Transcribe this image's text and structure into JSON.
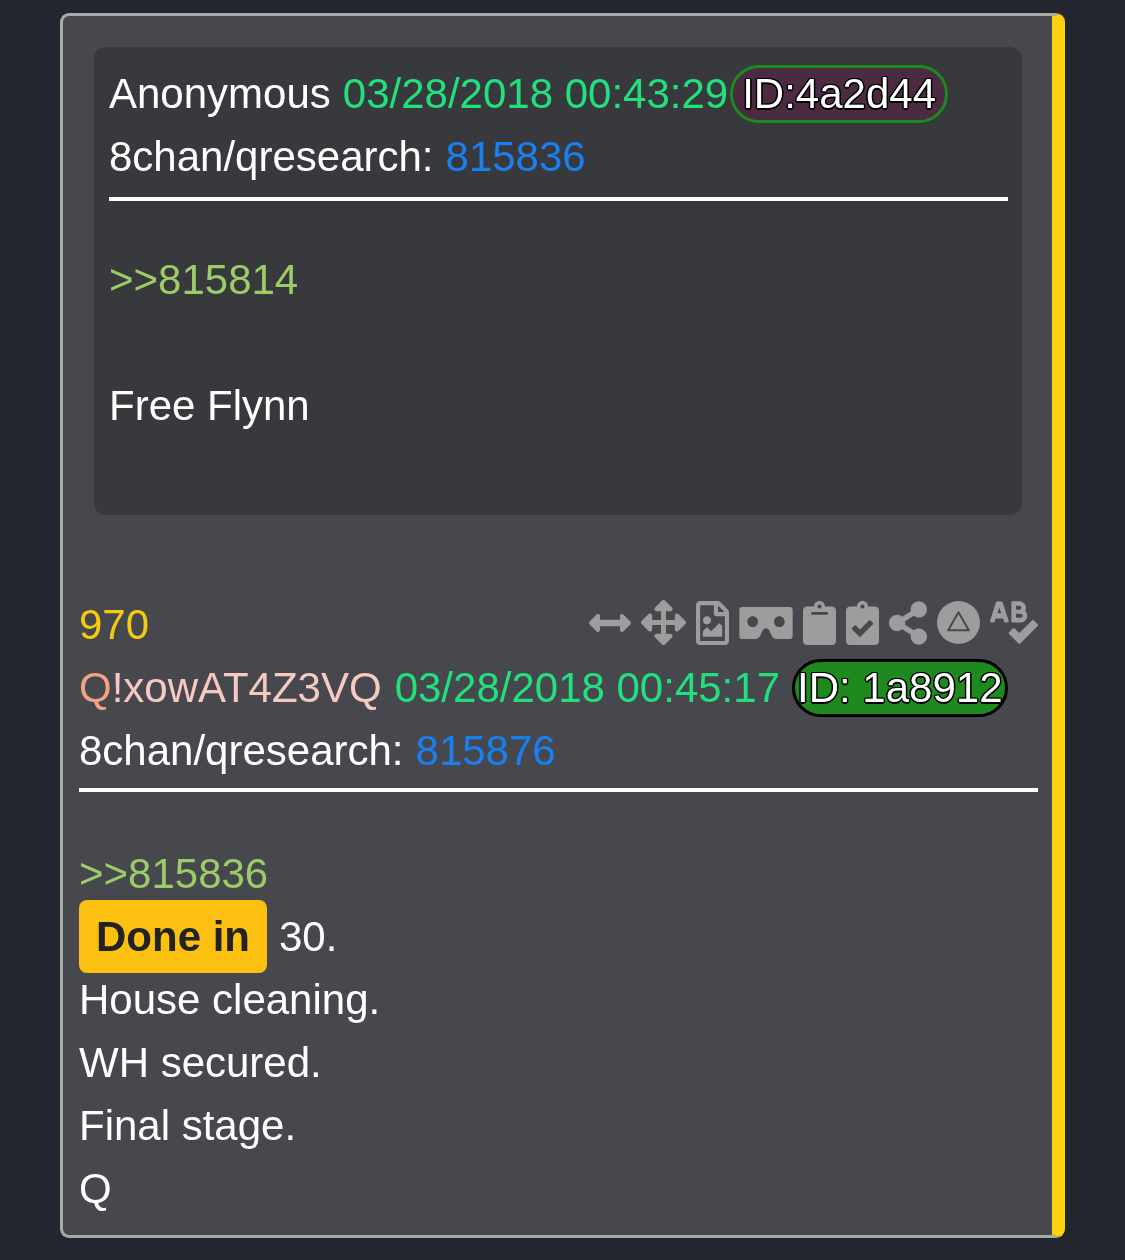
{
  "quoted_post": {
    "author": "Anonymous",
    "timestamp": "03/28/2018 00:43:29",
    "poster_id": {
      "label": "ID:4a2d44",
      "color": "#4a2b42",
      "outline": {
        "color": "#1c8a1c"
      }
    },
    "board": "8chan/qresearch:",
    "post_number": "815836",
    "body": [
      {
        "kind": "reply_link",
        "text": ">>815814"
      },
      {
        "kind": "text",
        "text": "Free Flynn"
      }
    ]
  },
  "post": {
    "number": "970",
    "author": {
      "name": "Q",
      "tripcode": "!xowAT4Z3VQ"
    },
    "timestamp": "03/28/2018 00:45:17",
    "poster_id": {
      "label": "ID: 1a8912",
      "color": "#1e8a1e",
      "outline": {
        "color": "#000000"
      }
    },
    "board": "8chan/qresearch:",
    "post_number": "815876",
    "body": [
      {
        "kind": "reply_link",
        "text": ">>815836"
      },
      {
        "kind": "text",
        "segments": [
          {
            "text": "Done in",
            "highlighted": true
          },
          {
            "text": "30.",
            "highlighted": false
          }
        ]
      },
      {
        "kind": "text",
        "text": "House cleaning."
      },
      {
        "kind": "text",
        "text": "WH secured."
      },
      {
        "kind": "text",
        "text": "Final stage."
      },
      {
        "kind": "text",
        "text": "Q"
      }
    ]
  }
}
